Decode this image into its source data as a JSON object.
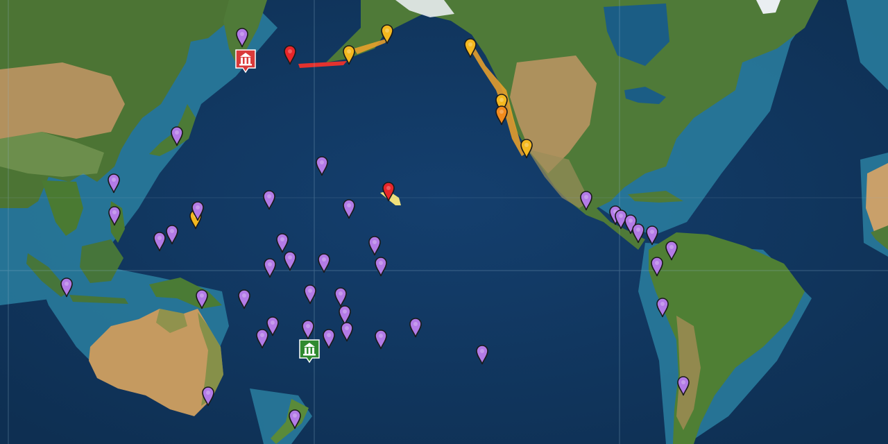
{
  "map": {
    "colors": {
      "deep_ocean": "#0f3459",
      "ocean": "#123e6b",
      "shelf": "#2f86a6",
      "land_green": "#3f6b2e",
      "land_dry": "#b98a55",
      "snow": "#f2f2f2"
    }
  },
  "legend": {
    "pin_colors": {
      "purple": "#b37be6",
      "yellow": "#f4b820",
      "orange": "#f28a1c",
      "red": "#e8262a"
    }
  },
  "stations": [
    {
      "name": "tsunami-warning-center-red",
      "color": "#d93a3a",
      "icon": "temple-icon"
    },
    {
      "name": "tsunami-warning-center-green",
      "color": "#2f8a2f",
      "icon": "temple-icon"
    }
  ],
  "markers": [
    {
      "color": "purple"
    },
    {
      "color": "red"
    },
    {
      "color": "yellow"
    },
    {
      "color": "yellow"
    },
    {
      "color": "yellow"
    },
    {
      "color": "yellow"
    },
    {
      "color": "orange"
    },
    {
      "color": "yellow"
    },
    {
      "color": "purple"
    },
    {
      "color": "purple"
    },
    {
      "color": "red"
    },
    {
      "color": "purple"
    },
    {
      "color": "purple"
    },
    {
      "color": "purple"
    },
    {
      "color": "yellow"
    },
    {
      "color": "purple"
    },
    {
      "color": "purple"
    },
    {
      "color": "purple"
    },
    {
      "color": "purple"
    },
    {
      "color": "purple"
    },
    {
      "color": "purple"
    },
    {
      "color": "purple"
    },
    {
      "color": "purple"
    },
    {
      "color": "purple"
    },
    {
      "color": "purple"
    },
    {
      "color": "purple"
    },
    {
      "color": "purple"
    },
    {
      "color": "purple"
    },
    {
      "color": "purple"
    },
    {
      "color": "purple"
    },
    {
      "color": "purple"
    },
    {
      "color": "purple"
    },
    {
      "color": "purple"
    },
    {
      "color": "purple"
    },
    {
      "color": "purple"
    },
    {
      "color": "purple"
    },
    {
      "color": "purple"
    },
    {
      "color": "purple"
    },
    {
      "color": "purple"
    },
    {
      "color": "purple"
    },
    {
      "color": "purple"
    },
    {
      "color": "purple"
    },
    {
      "color": "purple"
    },
    {
      "color": "purple"
    },
    {
      "color": "purple"
    },
    {
      "color": "purple"
    },
    {
      "color": "purple"
    },
    {
      "color": "purple"
    }
  ]
}
